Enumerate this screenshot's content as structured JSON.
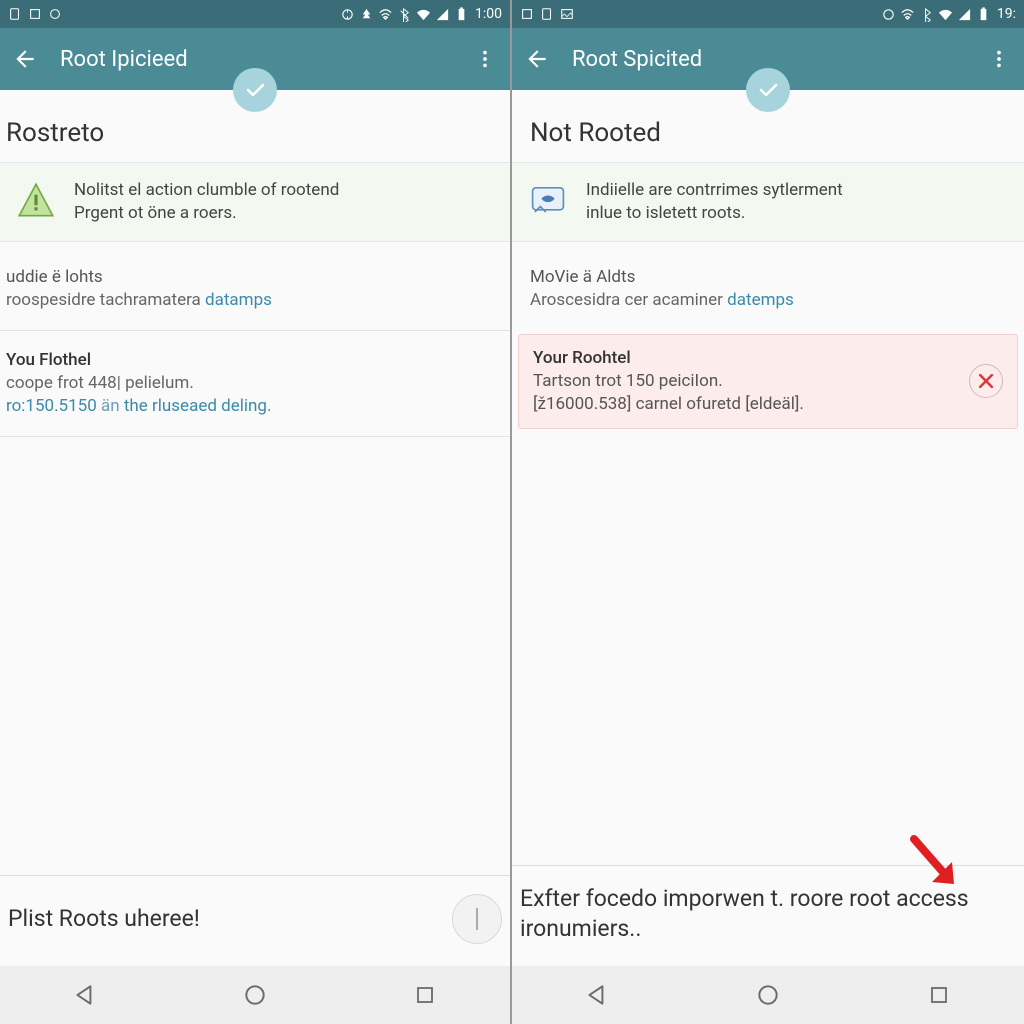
{
  "left": {
    "status_time": "1:00",
    "app_title": "Root Ipicieed",
    "heading": "Rostreto",
    "info_line1": "Nolitst el action clumble of rootend",
    "info_line2": "Prgent ot öne a roers.",
    "block1_line1": "uddie ë lohts",
    "block1_line2a": "roospesidre tachramatera ",
    "block1_link": "datamps",
    "block2_title": "You Flothel",
    "block2_line1": "coope frot 448| pelielum.",
    "block2_line2a": "ro:150.5150 ",
    "block2_line2b": "än",
    "block2_line2c": " the rluseaed deling.",
    "bottom_text": "Plist Roots uheree!"
  },
  "right": {
    "status_time": "19:",
    "app_title": "Root Spicited",
    "heading": "Not Rooted",
    "info_line1": "Indiielle are contrrimes sytlerment",
    "info_line2": "inlue to isletett roots.",
    "block1_line1": "MoVie ä Aldts",
    "block1_line2a": "Aroscesidra cer acaminer ",
    "block1_link": "datemps",
    "err_title": "Your Roohtel",
    "err_line1": "Tartson trot 150 peiciIon.",
    "err_line2": "[ž16000.538] carnel ofuretd [eldeäl].",
    "bottom_text": "Exfter focedo imporwen t. roore root access ironumiers.."
  }
}
